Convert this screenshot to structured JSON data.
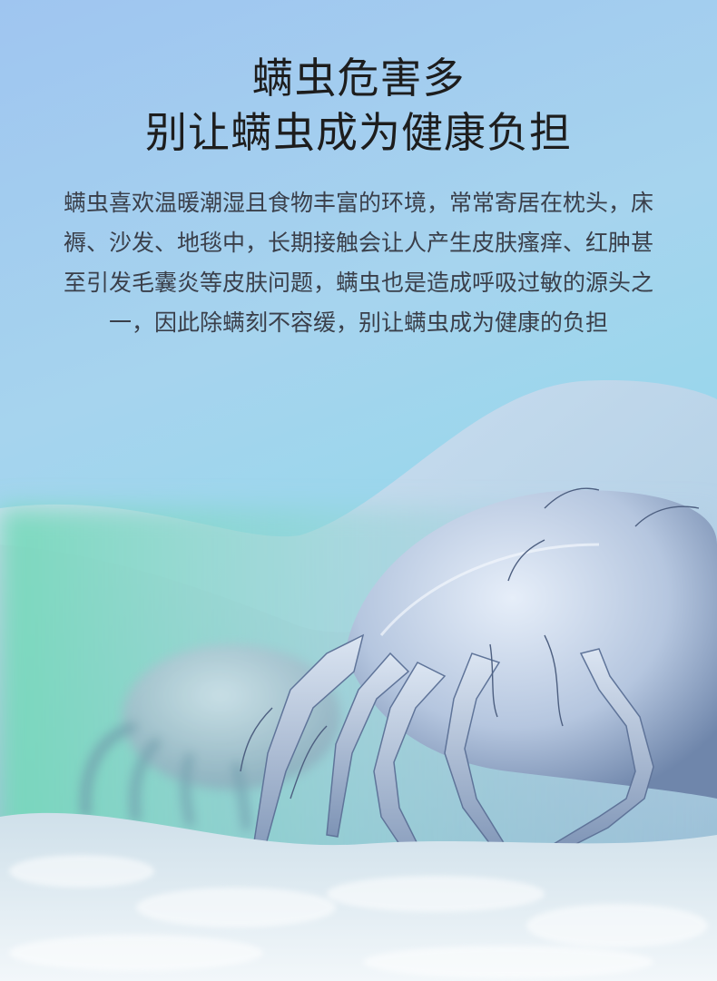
{
  "heading": {
    "line1": "螨虫危害多",
    "line2": "别让螨虫成为健康负担"
  },
  "body": {
    "paragraph": "螨虫喜欢温暖潮湿且食物丰富的环境，常常寄居在枕头，床褥、沙发、地毯中，长期接触会让人产生皮肤瘙痒、红肿甚至引发毛囊炎等皮肤问题，螨虫也是造成呼吸过敏的源头之一，因此除螨刻不容缓，别让螨虫成为健康的负担"
  },
  "colors": {
    "sky_top": "#9fc5f0",
    "sky_bottom": "#7fd8e4",
    "mite_body": "#c9d6ea",
    "mite_shadow": "#6d84a8",
    "fabric": "#e3eef4",
    "mint_haze": "#7fe0c8"
  }
}
